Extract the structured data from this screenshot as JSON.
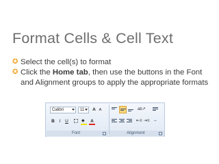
{
  "slide": {
    "title": "Format Cells & Cell Text",
    "bullets": [
      {
        "plain": "Select the cell(s) to format",
        "bold": "",
        "rest": ""
      },
      {
        "plain": "Click the ",
        "bold": "Home tab",
        "rest": ", then use the buttons in the Font and Alignment groups to apply the appropriate formats"
      }
    ],
    "bullet_color": "#f0a01e"
  },
  "ribbon": {
    "font_name": "Calibri",
    "font_size": "11",
    "grow_label": "A",
    "shrink_label": "A",
    "bold_label": "B",
    "italic_label": "I",
    "underline_label": "U",
    "font_color_label": "A",
    "font_group_label": "Font",
    "alignment_group_label": "Alignment"
  }
}
